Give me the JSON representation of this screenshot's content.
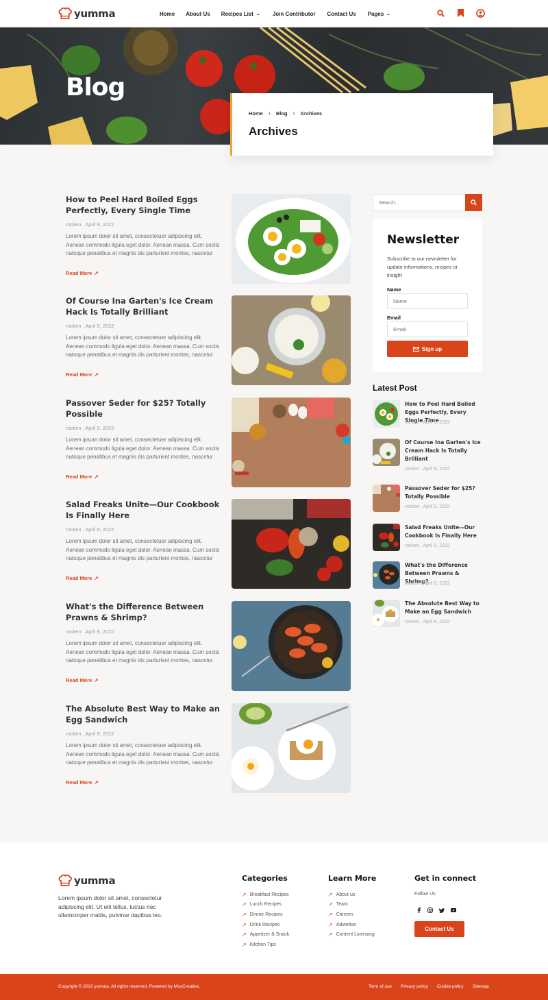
{
  "brand": {
    "name": "yumma",
    "accent": "#d9441b",
    "highlight": "#e7a33a",
    "hat_icon": "chef-hat-icon"
  },
  "nav": [
    {
      "label": "Home",
      "dropdown": false
    },
    {
      "label": "About Us",
      "dropdown": false
    },
    {
      "label": "Recipes List",
      "dropdown": true
    },
    {
      "label": "Join Contributor",
      "dropdown": false
    },
    {
      "label": "Contact Us",
      "dropdown": false
    },
    {
      "label": "Pages",
      "dropdown": true
    }
  ],
  "header_icons": [
    "search-icon",
    "bookmark-icon",
    "user-icon"
  ],
  "hero": {
    "title": "Blog"
  },
  "breadcrumb": {
    "items": [
      "Home",
      "Blog",
      "Archives"
    ],
    "title": "Archives"
  },
  "posts": [
    {
      "title": "How to Peel Hard Boiled Eggs Perfectly, Every Single Time",
      "meta": "rocken . April 9, 2022",
      "excerpt": "Lorem ipsum dolor sit amet, consectetuer adipiscing elit. Aenean commodo ligula eget dolor. Aenean massa. Cum sociis natoque penatibus et magnis dis parturient montes, nascetur",
      "more": "Read More",
      "image": "egg-salad"
    },
    {
      "title": "Of Course Ina Garten's Ice Cream Hack Is Totally Brilliant",
      "meta": "rocken . April 9, 2022",
      "excerpt": "Lorem ipsum dolor sit amet, consectetuer adipiscing elit. Aenean commodo ligula eget dolor. Aenean massa. Cum sociis natoque penatibus et magnis dis parturient montes, nascetur",
      "more": "Read More",
      "image": "ice-cream"
    },
    {
      "title": "Passover Seder for $25? Totally Possible",
      "meta": "rocken . April 9, 2022",
      "excerpt": "Lorem ipsum dolor sit amet, consectetuer adipiscing elit. Aenean commodo ligula eget dolor. Aenean massa. Cum sociis natoque penatibus et magnis dis parturient montes, nascetur",
      "more": "Read More",
      "image": "passover"
    },
    {
      "title": "Salad Freaks Unite—Our Cookbook Is Finally Here",
      "meta": "rocken . April 9, 2022",
      "excerpt": "Lorem ipsum dolor sit amet, consectetuer adipiscing elit. Aenean commodo ligula eget dolor. Aenean massa. Cum sociis natoque penatibus et magnis dis parturient montes, nascetur",
      "more": "Read More",
      "image": "vegetables"
    },
    {
      "title": "What's the Difference Between Prawns & Shrimp?",
      "meta": "rocken . April 9, 2022",
      "excerpt": "Lorem ipsum dolor sit amet, consectetuer adipiscing elit. Aenean commodo ligula eget dolor. Aenean massa. Cum sociis natoque penatibus et magnis dis parturient montes, nascetur",
      "more": "Read More",
      "image": "prawns"
    },
    {
      "title": "The Absolute Best Way to Make an Egg Sandwich",
      "meta": "rocken . April 9, 2022",
      "excerpt": "Lorem ipsum dolor sit amet, consectetuer adipiscing elit. Aenean commodo ligula eget dolor. Aenean massa. Cum sociis natoque penatibus et magnis dis parturient montes, nascetur",
      "more": "Read More",
      "image": "egg-sandwich"
    }
  ],
  "search": {
    "placeholder": "Search..."
  },
  "newsletter": {
    "title": "Newsletter",
    "description": "Subscribe to our newsletter for update informations, recipes or insight",
    "name_label": "Name",
    "name_placeholder": "Name",
    "email_label": "Email",
    "email_placeholder": "Email",
    "button": "Sign up"
  },
  "latest": {
    "title": "Latest Post",
    "items": [
      {
        "title": "How to Peel Hard Boiled Eggs Perfectly, Every Single Time",
        "meta": "rocken . April 9, 2022"
      },
      {
        "title": "Of Course Ina Garten's Ice Cream Hack Is Totally Brilliant",
        "meta": "rocken . April 9, 2022"
      },
      {
        "title": "Passover Seder for $25? Totally Possible",
        "meta": "rocken . April 9, 2022"
      },
      {
        "title": "Salad Freaks Unite—Our Cookbook Is Finally Here",
        "meta": "rocken . April 9, 2022"
      },
      {
        "title": "What's the Difference Between Prawns & Shrimp?",
        "meta": "rocken . April 9, 2022"
      },
      {
        "title": "The Absolute Best Way to Make an Egg Sandwich",
        "meta": "rocken . April 9, 2022"
      }
    ]
  },
  "footer": {
    "description": "Lorem ipsum dolor sit amet, consectetur adipiscing elit. Ut elit tellus, luctus nec ullamcorper mattis, pulvinar dapibus leo.",
    "categories": {
      "title": "Categories",
      "links": [
        "Breakfast Recipes",
        "Lunch Recipes",
        "Dinner Recipes",
        "Drink Recipes",
        "Appetizer & Snack",
        "Kitchen Tips"
      ]
    },
    "learn": {
      "title": "Learn More",
      "links": [
        "About us",
        "Team",
        "Careers",
        "Advertise",
        "Content Licensing"
      ]
    },
    "connect": {
      "title": "Get in connect",
      "follow": "Follow Us",
      "socials": [
        "facebook-icon",
        "instagram-icon",
        "twitter-icon",
        "youtube-icon"
      ],
      "button": "Contact Us"
    },
    "copyright": "Copyright © 2022 yumma, All rights reserved. Powered by MoxCreative.",
    "legal": [
      "Term of use",
      "Privacy policy",
      "Cookie policy",
      "Sitemap"
    ]
  }
}
